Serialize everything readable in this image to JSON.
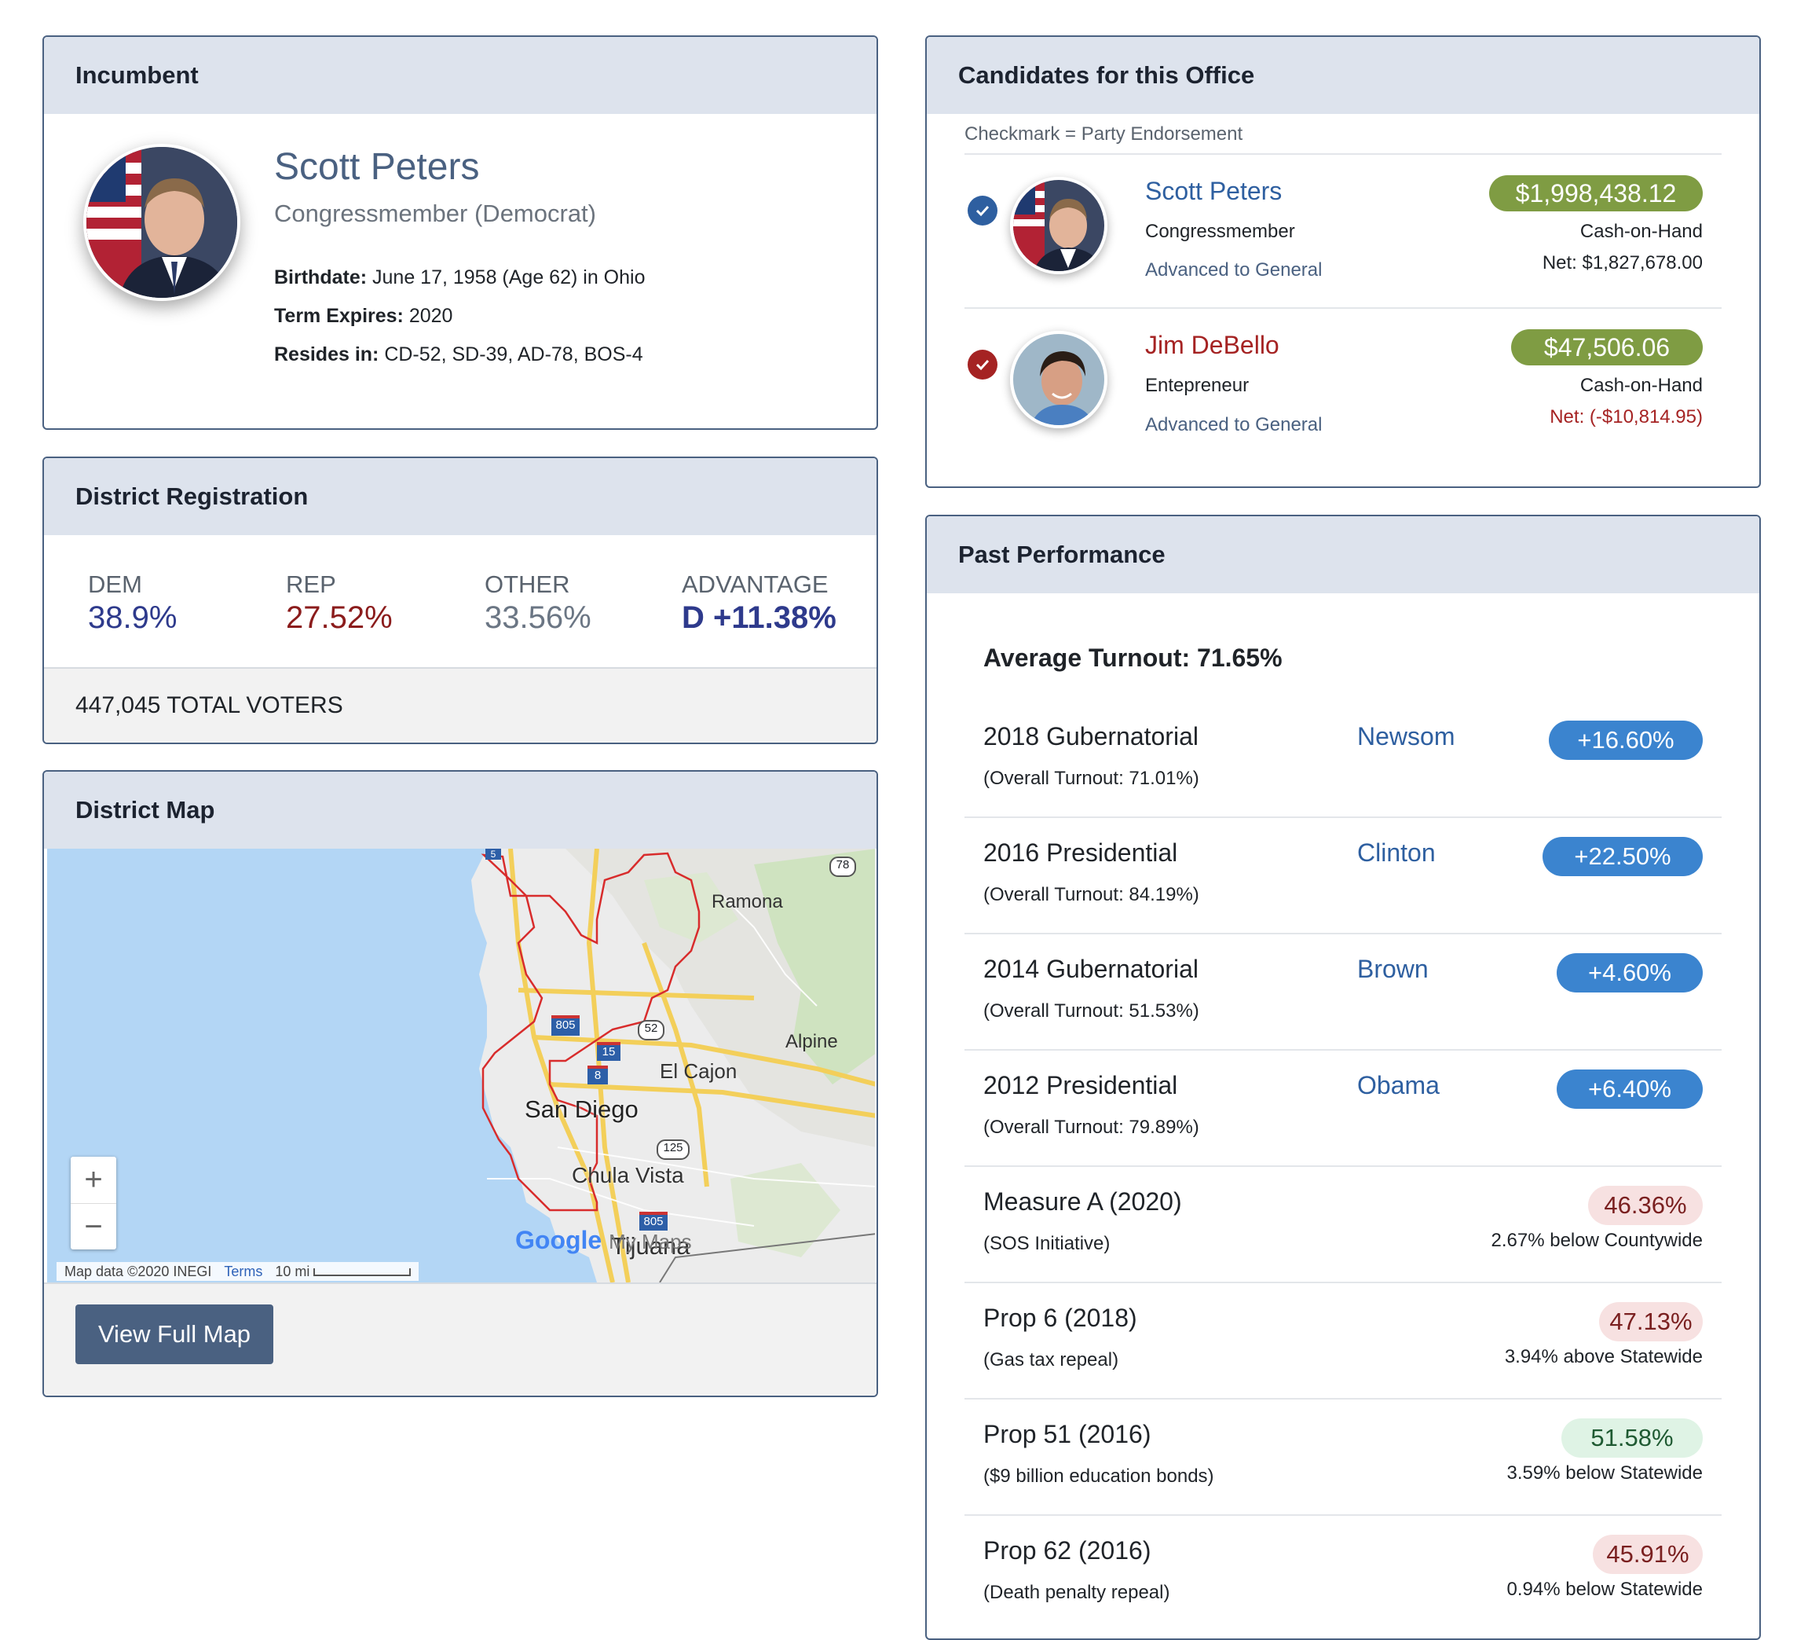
{
  "incumbent": {
    "header": "Incumbent",
    "name": "Scott Peters",
    "role": "Congressmember (Democrat)",
    "birthdate_label": "Birthdate:",
    "birthdate": "June 17, 1958 (Age 62) in Ohio",
    "term_label": "Term Expires:",
    "term": "2020",
    "resides_label": "Resides in:",
    "resides": "CD-52, SD-39, AD-78, BOS-4"
  },
  "registration": {
    "header": "District Registration",
    "columns": [
      {
        "label": "DEM",
        "value": "38.9%",
        "color": "#2e3a8c"
      },
      {
        "label": "REP",
        "value": "27.52%",
        "color": "#8b1c1c"
      },
      {
        "label": "OTHER",
        "value": "33.56%",
        "color": "#6b7684"
      },
      {
        "label": "ADVANTAGE",
        "value": "D +11.38%",
        "color": "#2e3a8c"
      }
    ],
    "total": "447,045 TOTAL VOTERS"
  },
  "map": {
    "header": "District Map",
    "labels": {
      "ramona": "Ramona",
      "alpine": "Alpine",
      "el_cajon": "El Cajon",
      "san_diego": "San Diego",
      "chula_vista": "Chula Vista",
      "tijuana": "Tijuana"
    },
    "shields": {
      "i805": "805",
      "i15": "15",
      "i8": "8",
      "r52": "52",
      "r125": "125",
      "r78": "78",
      "i805b": "805",
      "i5": "5"
    },
    "zoom_in": "+",
    "zoom_out": "−",
    "attribution": "Map data ©2020 INEGI",
    "terms": "Terms",
    "scale": "10 mi",
    "google": "Google",
    "mymaps": "My Maps",
    "button": "View Full Map"
  },
  "candidates": {
    "header": "Candidates for this Office",
    "note": "Checkmark = Party Endorsement",
    "list": [
      {
        "name": "Scott Peters",
        "occupation": "Congressmember",
        "status": "Advanced to General",
        "cash": "$1,998,438.12",
        "cash_label": "Cash-on-Hand",
        "net": "Net: $1,827,678.00",
        "party_color": "#2e5fa0"
      },
      {
        "name": "Jim DeBello",
        "occupation": "Entepreneur",
        "status": "Advanced to General",
        "cash": "$47,506.06",
        "cash_label": "Cash-on-Hand",
        "net": "Net: (-$10,814.95)",
        "party_color": "#a52323"
      }
    ]
  },
  "past": {
    "header": "Past Performance",
    "avg_turnout": "Average Turnout: 71.65%",
    "elections": [
      {
        "name": "2018 Gubernatorial",
        "sub": "(Overall Turnout: 71.01%)",
        "winner": "Newsom",
        "margin": "+16.60%"
      },
      {
        "name": "2016 Presidential",
        "sub": "(Overall Turnout: 84.19%)",
        "winner": "Clinton",
        "margin": "+22.50%"
      },
      {
        "name": "2014 Gubernatorial",
        "sub": "(Overall Turnout: 51.53%)",
        "winner": "Brown",
        "margin": "+4.60%"
      },
      {
        "name": "2012 Presidential",
        "sub": "(Overall Turnout: 79.89%)",
        "winner": "Obama",
        "margin": "+6.40%"
      }
    ],
    "measures": [
      {
        "name": "Measure A (2020)",
        "sub": "(SOS Initiative)",
        "pct": "46.36%",
        "cmp": "2.67% below Countywide",
        "result": "fail"
      },
      {
        "name": "Prop 6 (2018)",
        "sub": "(Gas tax repeal)",
        "pct": "47.13%",
        "cmp": "3.94% above Statewide",
        "result": "fail"
      },
      {
        "name": "Prop 51 (2016)",
        "sub": "($9 billion education bonds)",
        "pct": "51.58%",
        "cmp": "3.59% below Statewide",
        "result": "pass"
      },
      {
        "name": "Prop 62 (2016)",
        "sub": "(Death penalty repeal)",
        "pct": "45.91%",
        "cmp": "0.94% below Statewide",
        "result": "fail"
      }
    ]
  }
}
